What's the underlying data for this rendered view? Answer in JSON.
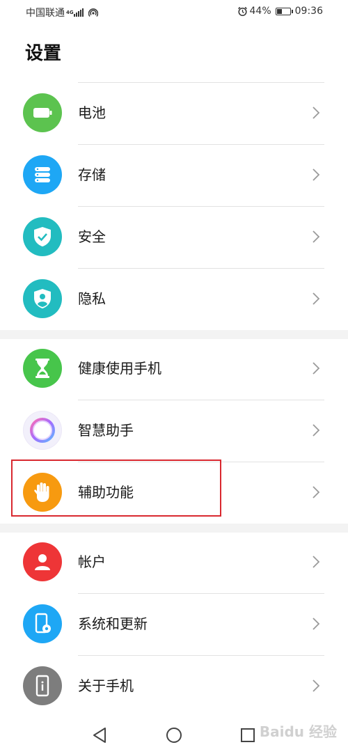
{
  "status_bar": {
    "carrier": "中国联通",
    "network_type": "4G",
    "alarm_icon": "alarm-icon",
    "battery_percent": "44%",
    "battery_level": 0.44,
    "time": "09:36"
  },
  "page": {
    "title": "设置"
  },
  "groups": [
    {
      "items": [
        {
          "label": "电池",
          "icon": "battery-icon",
          "color": "#5cc34f"
        },
        {
          "label": "存储",
          "icon": "storage-icon",
          "color": "#1ea7f5"
        },
        {
          "label": "安全",
          "icon": "shield-check-icon",
          "color": "#22bcc0"
        },
        {
          "label": "隐私",
          "icon": "privacy-icon",
          "color": "#22bcc0"
        }
      ]
    },
    {
      "items": [
        {
          "label": "健康使用手机",
          "icon": "hourglass-icon",
          "color": "#47c54b"
        },
        {
          "label": "智慧助手",
          "icon": "assistant-ring-icon",
          "color": "#f2f0fb"
        },
        {
          "label": "辅助功能",
          "icon": "hand-icon",
          "color": "#f79a10"
        }
      ]
    },
    {
      "items": [
        {
          "label": "帐户",
          "icon": "account-icon",
          "color": "#ee3537"
        },
        {
          "label": "系统和更新",
          "icon": "system-update-icon",
          "color": "#1ea7f5"
        },
        {
          "label": "关于手机",
          "icon": "phone-info-icon",
          "color": "#7d7d7d"
        }
      ]
    }
  ],
  "highlight": {
    "color": "#d9282f"
  },
  "nav": {
    "back": "back-icon",
    "home": "home-icon",
    "recents": "recents-icon"
  },
  "watermark": "Baidu 经验"
}
